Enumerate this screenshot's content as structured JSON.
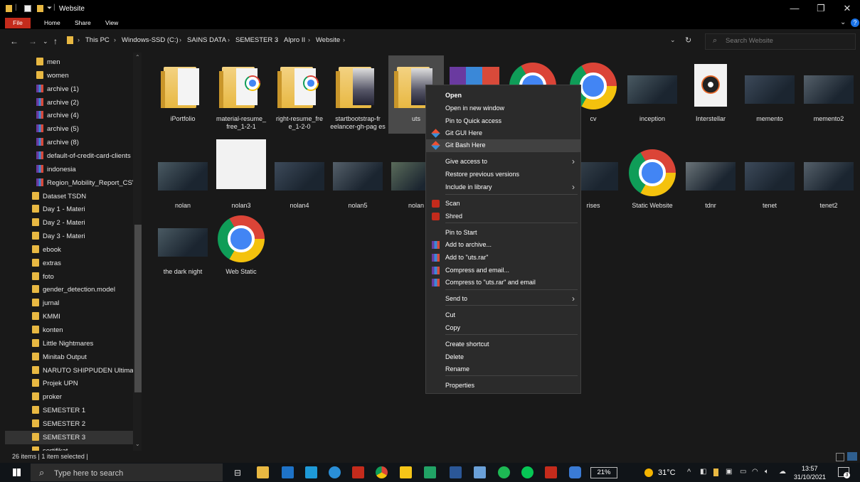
{
  "window": {
    "title": "Website",
    "controls": {
      "minimize": "—",
      "maximize": "❐",
      "close": "✕"
    }
  },
  "ribbon": {
    "file": "File",
    "home": "Home",
    "share": "Share",
    "view": "View"
  },
  "address": {
    "crumbs": [
      "This PC",
      "Windows-SSD (C:)",
      "SAINS DATA",
      "SEMESTER 3",
      "Alpro II",
      "Website"
    ],
    "search_placeholder": "Search Website"
  },
  "sidebar": {
    "items": [
      {
        "label": "men",
        "icon": "folder-icon"
      },
      {
        "label": "women",
        "icon": "folder-icon"
      },
      {
        "label": "archive (1)",
        "icon": "rar-icon"
      },
      {
        "label": "archive (2)",
        "icon": "rar-icon"
      },
      {
        "label": "archive (4)",
        "icon": "rar-icon"
      },
      {
        "label": "archive (5)",
        "icon": "rar-icon"
      },
      {
        "label": "archive (8)",
        "icon": "rar-icon"
      },
      {
        "label": "default-of-credit-card-clients",
        "icon": "rar-icon"
      },
      {
        "label": "indonesia",
        "icon": "rar-icon"
      },
      {
        "label": "Region_Mobility_Report_CSVs",
        "icon": "rar-icon"
      },
      {
        "label": "Dataset TSDN",
        "icon": "folder-icon"
      },
      {
        "label": "Day 1 - Materi",
        "icon": "folder-icon"
      },
      {
        "label": "Day 2 - Materi",
        "icon": "folder-icon"
      },
      {
        "label": "Day 3 - Materi",
        "icon": "folder-icon"
      },
      {
        "label": "ebook",
        "icon": "folder-icon"
      },
      {
        "label": "extras",
        "icon": "folder-icon"
      },
      {
        "label": "foto",
        "icon": "folder-icon"
      },
      {
        "label": "gender_detection.model",
        "icon": "folder-icon"
      },
      {
        "label": "jurnal",
        "icon": "folder-icon"
      },
      {
        "label": "KMMI",
        "icon": "folder-icon"
      },
      {
        "label": "konten",
        "icon": "folder-icon"
      },
      {
        "label": "Little Nightmares",
        "icon": "folder-icon"
      },
      {
        "label": "Minitab Output",
        "icon": "folder-icon"
      },
      {
        "label": "NARUTO SHIPPUDEN Ultimate",
        "icon": "folder-icon"
      },
      {
        "label": "Projek UPN",
        "icon": "folder-icon"
      },
      {
        "label": "proker",
        "icon": "folder-icon"
      },
      {
        "label": "SEMESTER 1",
        "icon": "folder-icon"
      },
      {
        "label": "SEMESTER 2",
        "icon": "folder-icon"
      },
      {
        "label": "SEMESTER 3",
        "icon": "folder-icon"
      },
      {
        "label": "sertifikat",
        "icon": "folder-icon"
      }
    ]
  },
  "files": {
    "row1": [
      "iPortfolio",
      "material-resume_ free_1-2-1",
      "right-resume_fre e_1-2-0",
      "startbootstrap-fr eelancer-gh-pag es",
      "uts",
      "",
      "",
      "cv",
      "inception",
      "Interstellar",
      "memento",
      "memento2"
    ],
    "row2": [
      "nolan",
      "nolan3",
      "nolan4",
      "nolan5",
      "nolan",
      "",
      "",
      "rises",
      "Static Website",
      "tdnr",
      "tenet",
      "tenet2"
    ],
    "row3": [
      "the dark night",
      "Web Static"
    ]
  },
  "context_menu": {
    "items": [
      "Open",
      "Open in new window",
      "Pin to Quick access",
      "Git GUI Here",
      "Git Bash Here",
      "Give access to",
      "Restore previous versions",
      "Include in library",
      "Scan",
      "Shred",
      "Pin to Start",
      "Add to archive...",
      "Add to \"uts.rar\"",
      "Compress and email...",
      "Compress to \"uts.rar\" and email",
      "Send to",
      "Cut",
      "Copy",
      "Create shortcut",
      "Delete",
      "Rename",
      "Properties"
    ]
  },
  "status": {
    "text": "26 items  |  1 item selected  |"
  },
  "taskbar": {
    "search_placeholder": "Type here to search",
    "battery": "21%",
    "weather": "31°C",
    "time": "13:57",
    "date": "31/10/2021",
    "notif": "3"
  },
  "colors": {
    "accent_red": "#c42b1c",
    "folder_yellow": "#e8b842",
    "menu_bg": "#2b2b2b"
  }
}
